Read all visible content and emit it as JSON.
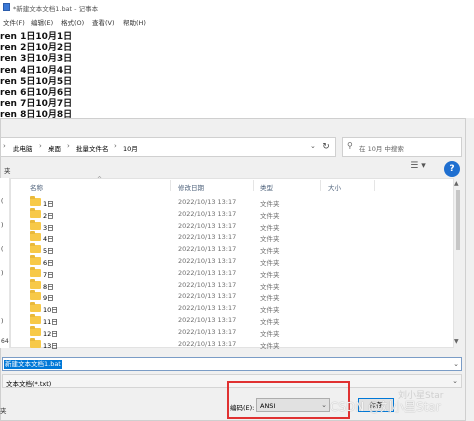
{
  "notepad": {
    "title": "*新建文本文档1.bat - 记事本",
    "menu": [
      "文件(F)",
      "编辑(E)",
      "格式(O)",
      "查看(V)",
      "帮助(H)"
    ],
    "lines": [
      "ren 1日10月1日",
      "ren 2日10月2日",
      "ren 3日10月3日",
      "ren 4日10月4日",
      "ren 5日10月5日",
      "ren 6日10月6日",
      "ren 7日10月7日",
      "ren 8日10月8日"
    ]
  },
  "dialog": {
    "breadcrumb": [
      "此电脑",
      "桌面",
      "批量文件名",
      "10月"
    ],
    "search_placeholder": "在 10月 中搜索",
    "left_nav_label": "夹",
    "columns": {
      "name": "名称",
      "date": "修改日期",
      "type": "类型",
      "size": "大小"
    },
    "rows": [
      {
        "name": "1日",
        "date": "2022/10/13 13:17",
        "type": "文件夹"
      },
      {
        "name": "2日",
        "date": "2022/10/13 13:17",
        "type": "文件夹"
      },
      {
        "name": "3日",
        "date": "2022/10/13 13:17",
        "type": "文件夹"
      },
      {
        "name": "4日",
        "date": "2022/10/13 13:17",
        "type": "文件夹"
      },
      {
        "name": "5日",
        "date": "2022/10/13 13:17",
        "type": "文件夹"
      },
      {
        "name": "6日",
        "date": "2022/10/13 13:17",
        "type": "文件夹"
      },
      {
        "name": "7日",
        "date": "2022/10/13 13:17",
        "type": "文件夹"
      },
      {
        "name": "8日",
        "date": "2022/10/13 13:17",
        "type": "文件夹"
      },
      {
        "name": "9日",
        "date": "2022/10/13 13:17",
        "type": "文件夹"
      },
      {
        "name": "10日",
        "date": "2022/10/13 13:17",
        "type": "文件夹"
      },
      {
        "name": "11日",
        "date": "2022/10/13 13:17",
        "type": "文件夹"
      },
      {
        "name": "12日",
        "date": "2022/10/13 13:17",
        "type": "文件夹"
      },
      {
        "name": "13日",
        "date": "2022/10/13 13:17",
        "type": "文件夹"
      }
    ],
    "left_labels": [
      "(",
      ")",
      "(",
      ")",
      "",
      ")",
      "64"
    ],
    "file_name": "新建文本文档1.bat",
    "file_type": "文本文档(*.txt)",
    "encoding_label": "编码(E):",
    "encoding_value": "ANSI",
    "save_label": "保存",
    "hide_folders": "夹"
  },
  "watermarks": {
    "csdn": "CSDN @刘小星Star",
    "wechat": "刘小星Star"
  },
  "colors": {
    "accent": "#0078d7",
    "highlight_box": "#e03131",
    "folder": "#f7c948"
  }
}
